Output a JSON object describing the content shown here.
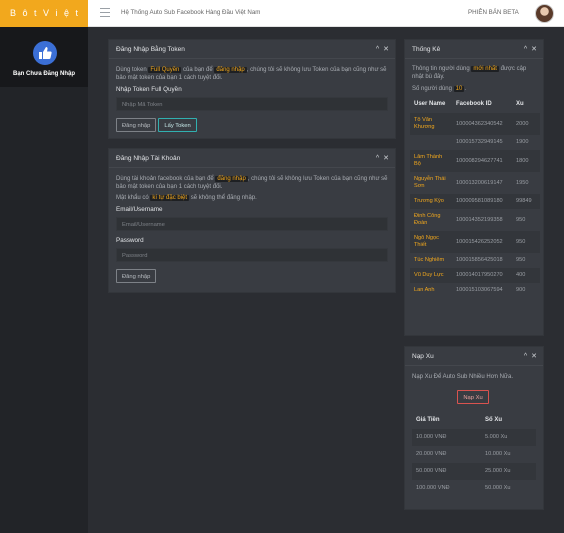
{
  "header": {
    "brand": "B ô t V i ệ t",
    "title": "Hệ Thống Auto Sub Facebook Hàng Đầu Việt Nam",
    "version": "PHIÊN BẢN BETA"
  },
  "sidebar": {
    "status": "Bạn Chưa Đăng Nhập"
  },
  "token_login": {
    "title": "Đăng Nhập Bằng Token",
    "desc_1": "Dùng token ",
    "desc_hl_1": "Full Quyền",
    "desc_2": " của bạn để ",
    "desc_hl_2": "đăng nhập",
    "desc_3": ", chúng tôi sẽ không lưu Token của bạn cũng như sẽ bảo mật token của bạn 1 cách tuyệt đối.",
    "field_label": "Nhập Token Full Quyền",
    "field_placeholder": "Nhập Mã Token",
    "login_button": "Đăng nhập",
    "get_token_button": "Lấy Token"
  },
  "account_login": {
    "title": "Đăng Nhập Tài Khoản",
    "desc_1": "Dùng tài khoản facebook của bạn để ",
    "desc_hl_1": "đăng nhập",
    "desc_2": ", chúng tôi sẽ không lưu Token của bạn cũng như sẽ bảo mật token của bạn 1 cách tuyệt đối.",
    "warn_1": "Mật khẩu có ",
    "warn_hl": "kí tự đặc biệt",
    "warn_2": " sẽ không thể đăng nhập.",
    "email_label": "Email/Username",
    "email_placeholder": "Email/Username",
    "password_label": "Password",
    "password_placeholder": "Password",
    "login_button": "Đăng nhập"
  },
  "stats": {
    "title": "Thống Kê",
    "desc_1": "Thông tin người dùng ",
    "desc_hl": "mới nhất",
    "desc_2": " được cập nhật bù đây.",
    "count_1": "Số người dùng ",
    "count_value": "10",
    "count_2": ".",
    "columns": [
      "User Name",
      "Facebook ID",
      "Xu"
    ],
    "rows": [
      {
        "name": "Tô Văn Khương",
        "id": "100004362340542",
        "xu": "2000"
      },
      {
        "name": "",
        "id": "100015732949145",
        "xu": "1900"
      },
      {
        "name": "Lâm Thành Bộ",
        "id": "100008294627741",
        "xu": "1800"
      },
      {
        "name": "Nguyễn Thái Sơn",
        "id": "100013200619147",
        "xu": "1950"
      },
      {
        "name": "Trương Kỳo",
        "id": "100009581089180",
        "xu": "99849"
      },
      {
        "name": "Đinh Công Đoàn",
        "id": "100014352199358",
        "xu": "950"
      },
      {
        "name": "Ngô Ngọc Thiết",
        "id": "100015426252052",
        "xu": "950"
      },
      {
        "name": "Túc Nghiêm",
        "id": "100015856425018",
        "xu": "950"
      },
      {
        "name": "Vũ Duy Lực",
        "id": "100014017950270",
        "xu": "400"
      },
      {
        "name": "Lan Anh",
        "id": "100015103067594",
        "xu": "900"
      }
    ]
  },
  "topup": {
    "title": "Nạp Xu",
    "desc": "Nạp Xu Để Auto Sub Nhiều Hơn Nữa.",
    "button": "Nạp Xu",
    "columns": [
      "Giá Tiền",
      "Số Xu"
    ],
    "rows": [
      {
        "price": "10.000 VNĐ",
        "xu": "5.000 Xu"
      },
      {
        "price": "20.000 VNĐ",
        "xu": "10.000 Xu"
      },
      {
        "price": "50.000 VNĐ",
        "xu": "25.000 Xu"
      },
      {
        "price": "100.000 VNĐ",
        "xu": "50.000 Xu"
      }
    ]
  }
}
